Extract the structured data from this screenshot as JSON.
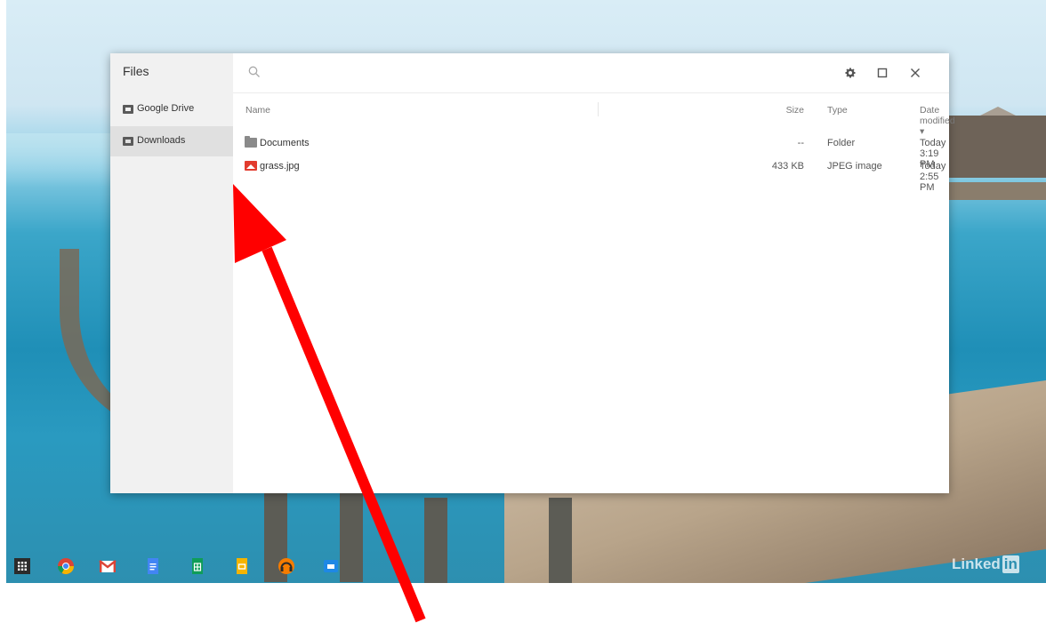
{
  "window": {
    "app_title": "Files"
  },
  "sidebar": {
    "items": [
      {
        "label": "Google Drive",
        "icon": "drive-icon",
        "selected": false
      },
      {
        "label": "Downloads",
        "icon": "downloads-folder-icon",
        "selected": true
      }
    ]
  },
  "toolbar": {
    "search_icon": "search-icon",
    "settings_icon": "gear-icon",
    "maximize_icon": "maximize-icon",
    "close_icon": "close-icon"
  },
  "file_list": {
    "columns": {
      "name": "Name",
      "size": "Size",
      "type": "Type",
      "date": "Date modified ▾"
    },
    "rows": [
      {
        "name": "Documents",
        "size": "--",
        "type": "Folder",
        "date": "Today 3:19 PM",
        "icon": "folder-icon"
      },
      {
        "name": "grass.jpg",
        "size": "433 KB",
        "type": "JPEG image",
        "date": "Today 2:55 PM",
        "icon": "image-file-icon"
      }
    ]
  },
  "shelf": {
    "apps": [
      "app-launcher-icon",
      "chrome-icon",
      "gmail-icon",
      "docs-icon",
      "sheets-icon",
      "slides-icon",
      "music-icon",
      "files-icon"
    ]
  },
  "watermark": {
    "text": "Linked",
    "badge": "in"
  },
  "colors": {
    "arrow": "#ff0000",
    "selected_nav": "#e0e0e0",
    "sidebar_bg": "#f1f1f1"
  }
}
